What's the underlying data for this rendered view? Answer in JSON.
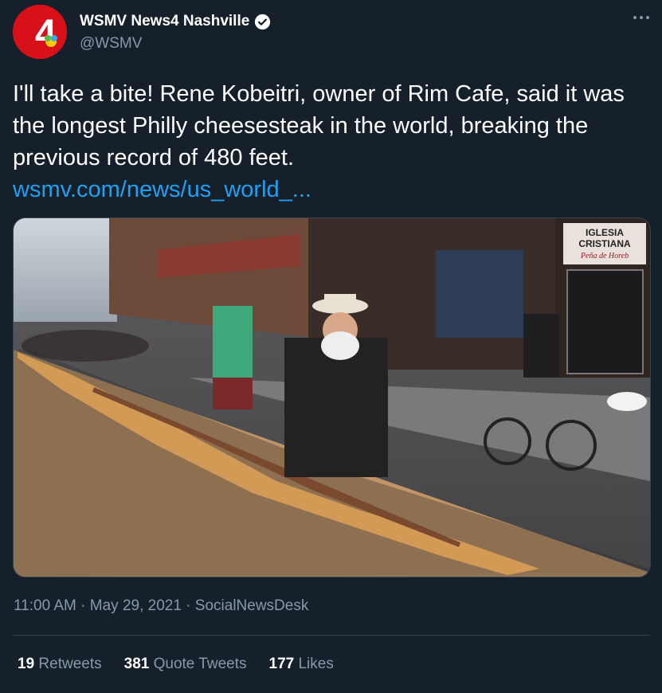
{
  "author": {
    "display_name": "WSMV News4 Nashville",
    "handle": "@WSMV",
    "avatar_text": "4"
  },
  "tweet": {
    "text": "I'll take a bite! Rene Kobeitri, owner of Rim Cafe, said it was the longest Philly cheesesteak in the world, breaking the previous record of 480 feet.",
    "link_text": "wsmv.com/news/us_world_..."
  },
  "media": {
    "sign_line1": "IGLESIA",
    "sign_line2": "CRISTIANA",
    "sign_line3": "Peña de Horeb"
  },
  "meta": {
    "time": "11:00 AM",
    "date": "May 29, 2021",
    "source": "SocialNewsDesk",
    "separator": "·"
  },
  "stats": {
    "retweets_count": "19",
    "retweets_label": "Retweets",
    "quotes_count": "381",
    "quotes_label": "Quote Tweets",
    "likes_count": "177",
    "likes_label": "Likes"
  },
  "colors": {
    "background": "#15202b",
    "secondary_text": "#8899a6",
    "link": "#1da1f2",
    "brand_red": "#e3001b"
  }
}
